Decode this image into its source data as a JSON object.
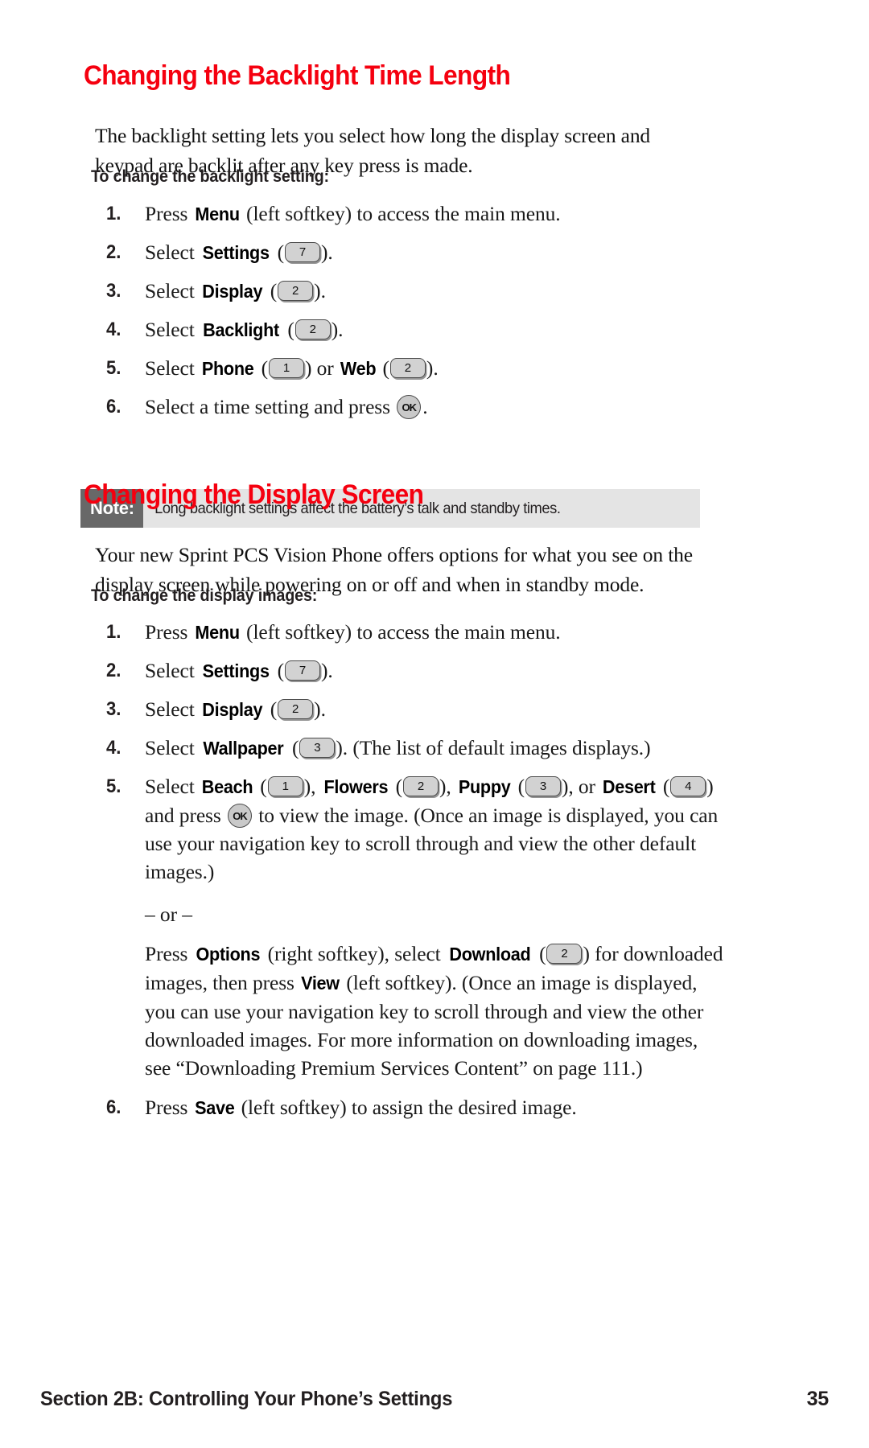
{
  "page": {
    "accent_red": "#f5000f",
    "note_label_bg": "#686868",
    "note_body_bg": "#e4e4e4",
    "keycap_fill": "#d2d2d2"
  },
  "section_backlight": {
    "heading": "Changing the Backlight Time Length",
    "intro": "The backlight setting lets you select how long the display screen and keypad are backlit after any key press is made.",
    "subhead": "To change the backlight setting:",
    "steps": [
      {
        "num": "1.",
        "pre": "Press ",
        "bold": "Menu",
        "post": " (left softkey) to access the main menu."
      },
      {
        "num": "2.",
        "pre": "Select ",
        "bold": "Settings",
        "key": "7",
        "post": "."
      },
      {
        "num": "3.",
        "pre": "Select ",
        "bold": "Display",
        "key": "2",
        "post": "."
      },
      {
        "num": "4.",
        "pre": "Select ",
        "bold": "Backlight",
        "key": "2",
        "post": "."
      },
      {
        "num": "5.",
        "pre": "Select ",
        "bold": "Phone",
        "key": "1",
        "mid": " or ",
        "bold2": "Web",
        "key2": "2",
        "post": "."
      },
      {
        "num": "6.",
        "pre": "Select a time setting and press ",
        "ok": "OK",
        "post": "."
      }
    ]
  },
  "note": {
    "label": "Note:",
    "text": "Long backlight settings affect the battery’s talk and standby times."
  },
  "section_display": {
    "heading": "Changing the Display Screen",
    "intro": "Your new Sprint PCS Vision Phone offers options for what you see on the display screen while powering on or off and when in standby mode.",
    "subhead": "To change the display images:",
    "steps": [
      {
        "num": "1.",
        "pre": "Press ",
        "bold": "Menu",
        "post": " (left softkey) to access the main menu."
      },
      {
        "num": "2.",
        "pre": "Select ",
        "bold": "Settings",
        "key": "7",
        "post": "."
      },
      {
        "num": "3.",
        "pre": "Select ",
        "bold": "Display",
        "key": "2",
        "post": "."
      },
      {
        "num": "4.",
        "pre": "Select ",
        "bold": "Wallpaper",
        "key": "3",
        "post": ". (The list of default images displays.)"
      },
      {
        "num": "5.",
        "pre": "Select ",
        "bold": "Beach",
        "key": "1",
        "sep1": "), ",
        "bold2": "Flowers",
        "key2": "2",
        "sep2": "), ",
        "bold3": "Puppy",
        "key3": "3",
        "sep3": "), or ",
        "bold4": "Desert",
        "key4": "4",
        "tail": ")",
        "cont_pre": "and press ",
        "ok": "OK",
        "cont_post": " to view the image. (Once an image is displayed, you can use your navigation key to scroll through and view the other default images.)",
        "or_label": "– or –",
        "alt_1": "Press ",
        "alt_bold1": "Options",
        "alt_2": " (right softkey), select ",
        "alt_bold2": "Download",
        "alt_key": "2",
        "alt_3": ") for downloaded images, then press ",
        "alt_bold3": "View",
        "alt_4": " (left softkey). (Once an image is displayed, you can use your navigation key to scroll through and view the other downloaded images. For more information on downloading images, see “Downloading Premium Services Content” on page 111.)"
      },
      {
        "num": "6.",
        "pre": "Press ",
        "bold": "Save",
        "post": " (left softkey) to assign the desired image."
      }
    ]
  },
  "footer": {
    "left": "Section 2B: Controlling Your Phone’s Settings",
    "page_number": "35"
  }
}
